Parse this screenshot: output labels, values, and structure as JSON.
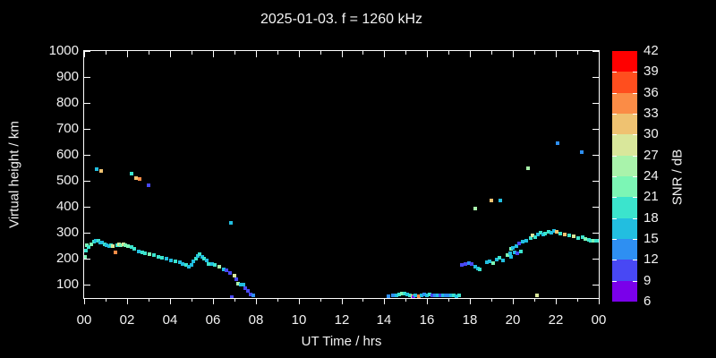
{
  "figure": {
    "title": "2025-01-03. f = 1260 kHz"
  },
  "chart_data": {
    "type": "scatter",
    "title": "2025-01-03. f = 1260 kHz",
    "xlabel": "UT Time / hrs",
    "ylabel": "Virtual height / km",
    "xlim": [
      0,
      24
    ],
    "ylim": [
      50,
      1000
    ],
    "x_major_tick_hours": [
      0,
      2,
      4,
      6,
      8,
      10,
      12,
      14,
      16,
      18,
      20,
      22,
      24
    ],
    "x_tick_labels": [
      "00",
      "02",
      "04",
      "06",
      "08",
      "10",
      "12",
      "14",
      "16",
      "18",
      "20",
      "22",
      "00"
    ],
    "x_minor_tick_hours": [
      1,
      3,
      5,
      7,
      9,
      11,
      13,
      15,
      17,
      19,
      21,
      23
    ],
    "y_major_ticks": [
      100,
      200,
      300,
      400,
      500,
      600,
      700,
      800,
      900,
      1000
    ],
    "grid": false,
    "legend_position": "colorbar-right",
    "background_color": "#000000",
    "frame_color": "#ffffff",
    "text_color": "#f2f2f2",
    "marker_shape": "square",
    "colorbar": {
      "label": "SNR / dB",
      "min": 6,
      "max": 42,
      "step": 3,
      "tick_values": [
        6,
        9,
        12,
        15,
        18,
        21,
        24,
        27,
        30,
        33,
        36,
        39,
        42
      ],
      "segment_colors_low_to_high": [
        "#7a00ea",
        "#4848f4",
        "#2e8ff2",
        "#22bee0",
        "#3be4cd",
        "#7cf6b5",
        "#a9f3ab",
        "#d9e79b",
        "#efc271",
        "#fb8c46",
        "#ff4e1e",
        "#ff0000"
      ]
    },
    "points_format": "[ut_hour, virtual_height_km, snr_color_index 0..11 into segment_colors_low_to_high]",
    "points": [
      [
        0.05,
        210,
        5
      ],
      [
        0.08,
        232,
        4
      ],
      [
        0.13,
        252,
        5
      ],
      [
        0.22,
        246,
        4
      ],
      [
        0.33,
        258,
        5
      ],
      [
        0.44,
        266,
        4
      ],
      [
        0.55,
        272,
        3
      ],
      [
        0.65,
        270,
        4
      ],
      [
        0.75,
        265,
        3
      ],
      [
        0.85,
        262,
        3
      ],
      [
        0.95,
        258,
        4
      ],
      [
        1.05,
        252,
        3
      ],
      [
        1.15,
        249,
        3
      ],
      [
        1.25,
        252,
        4
      ],
      [
        1.35,
        249,
        7
      ],
      [
        1.45,
        226,
        9
      ],
      [
        1.55,
        252,
        4
      ],
      [
        1.62,
        255,
        7
      ],
      [
        1.72,
        253,
        5
      ],
      [
        1.82,
        256,
        7
      ],
      [
        1.92,
        252,
        5
      ],
      [
        2.05,
        250,
        5
      ],
      [
        2.2,
        247,
        4
      ],
      [
        2.35,
        240,
        4
      ],
      [
        2.55,
        228,
        3
      ],
      [
        2.7,
        225,
        4
      ],
      [
        2.85,
        222,
        4
      ],
      [
        3.05,
        218,
        5
      ],
      [
        3.25,
        214,
        4
      ],
      [
        3.45,
        210,
        4
      ],
      [
        3.65,
        206,
        4
      ],
      [
        3.85,
        202,
        3
      ],
      [
        4.05,
        196,
        3
      ],
      [
        4.25,
        192,
        4
      ],
      [
        4.45,
        186,
        3
      ],
      [
        4.6,
        180,
        3
      ],
      [
        4.75,
        178,
        4
      ],
      [
        4.9,
        172,
        3
      ],
      [
        5.0,
        178,
        3
      ],
      [
        5.1,
        190,
        3
      ],
      [
        5.2,
        200,
        4
      ],
      [
        5.3,
        212,
        3
      ],
      [
        5.4,
        218,
        4
      ],
      [
        5.5,
        210,
        3
      ],
      [
        5.6,
        202,
        4
      ],
      [
        5.7,
        195,
        3
      ],
      [
        5.8,
        182,
        4
      ],
      [
        5.95,
        182,
        3
      ],
      [
        6.1,
        176,
        4
      ],
      [
        6.3,
        170,
        6
      ],
      [
        6.5,
        160,
        3
      ],
      [
        6.65,
        155,
        1
      ],
      [
        6.8,
        148,
        1
      ],
      [
        7.0,
        137,
        7
      ],
      [
        7.1,
        123,
        1
      ],
      [
        7.18,
        106,
        6
      ],
      [
        7.3,
        102,
        3
      ],
      [
        7.42,
        102,
        3
      ],
      [
        7.52,
        88,
        1
      ],
      [
        7.65,
        79,
        1
      ],
      [
        7.78,
        63,
        1
      ],
      [
        7.9,
        59,
        2
      ],
      [
        0.6,
        545,
        3
      ],
      [
        0.8,
        540,
        8
      ],
      [
        2.22,
        530,
        4
      ],
      [
        2.43,
        510,
        8
      ],
      [
        2.57,
        508,
        9
      ],
      [
        3.0,
        485,
        1
      ],
      [
        6.85,
        340,
        3
      ],
      [
        6.88,
        54,
        1
      ],
      [
        14.2,
        58,
        2
      ],
      [
        14.4,
        62,
        2
      ],
      [
        14.55,
        60,
        3
      ],
      [
        14.7,
        65,
        4
      ],
      [
        14.82,
        68,
        5
      ],
      [
        14.95,
        67,
        4
      ],
      [
        15.08,
        63,
        3
      ],
      [
        15.2,
        60,
        4
      ],
      [
        15.32,
        58,
        7
      ],
      [
        15.35,
        52,
        0
      ],
      [
        15.45,
        60,
        3
      ],
      [
        15.6,
        58,
        9
      ],
      [
        15.72,
        62,
        3
      ],
      [
        15.85,
        65,
        2
      ],
      [
        15.98,
        62,
        3
      ],
      [
        16.1,
        64,
        4
      ],
      [
        16.22,
        62,
        1
      ],
      [
        16.35,
        60,
        2
      ],
      [
        16.5,
        62,
        3
      ],
      [
        16.62,
        60,
        1
      ],
      [
        16.75,
        62,
        3
      ],
      [
        16.88,
        60,
        2
      ],
      [
        17.0,
        62,
        2
      ],
      [
        17.12,
        60,
        3
      ],
      [
        17.25,
        62,
        4
      ],
      [
        17.38,
        58,
        3
      ],
      [
        17.5,
        60,
        4
      ],
      [
        17.6,
        177,
        1
      ],
      [
        17.76,
        180,
        1
      ],
      [
        17.93,
        184,
        2
      ],
      [
        18.08,
        180,
        1
      ],
      [
        18.22,
        172,
        3
      ],
      [
        18.36,
        165,
        3
      ],
      [
        18.46,
        161,
        4
      ],
      [
        18.78,
        186,
        3
      ],
      [
        18.92,
        191,
        3
      ],
      [
        19.08,
        184,
        5
      ],
      [
        19.25,
        198,
        3
      ],
      [
        19.36,
        204,
        4
      ],
      [
        19.53,
        194,
        3
      ],
      [
        19.75,
        216,
        5
      ],
      [
        19.85,
        223,
        3
      ],
      [
        19.92,
        209,
        3
      ],
      [
        20.08,
        226,
        3
      ],
      [
        20.2,
        222,
        1
      ],
      [
        20.35,
        230,
        4
      ],
      [
        19.89,
        238,
        5
      ],
      [
        19.98,
        243,
        3
      ],
      [
        20.14,
        249,
        3
      ],
      [
        20.3,
        260,
        1
      ],
      [
        20.45,
        266,
        3
      ],
      [
        20.6,
        270,
        3
      ],
      [
        20.82,
        281,
        4
      ],
      [
        20.93,
        290,
        7
      ],
      [
        21.03,
        284,
        4
      ],
      [
        21.17,
        295,
        3
      ],
      [
        21.3,
        301,
        4
      ],
      [
        21.4,
        293,
        3
      ],
      [
        21.51,
        298,
        4
      ],
      [
        21.65,
        304,
        4
      ],
      [
        21.79,
        301,
        3
      ],
      [
        21.93,
        309,
        3
      ],
      [
        22.04,
        304,
        8
      ],
      [
        22.21,
        298,
        4
      ],
      [
        22.42,
        293,
        8
      ],
      [
        22.62,
        290,
        4
      ],
      [
        22.83,
        286,
        7
      ],
      [
        23.04,
        281,
        4
      ],
      [
        23.25,
        284,
        4
      ],
      [
        23.39,
        278,
        5
      ],
      [
        23.52,
        274,
        4
      ],
      [
        23.64,
        272,
        4
      ],
      [
        23.75,
        272,
        5
      ],
      [
        23.86,
        270,
        4
      ],
      [
        23.96,
        270,
        4
      ],
      [
        18.25,
        395,
        6
      ],
      [
        19.0,
        424,
        8
      ],
      [
        19.4,
        424,
        3
      ],
      [
        20.7,
        548,
        6
      ],
      [
        21.1,
        62,
        7
      ],
      [
        22.1,
        645,
        2
      ],
      [
        23.2,
        611,
        2
      ]
    ]
  }
}
